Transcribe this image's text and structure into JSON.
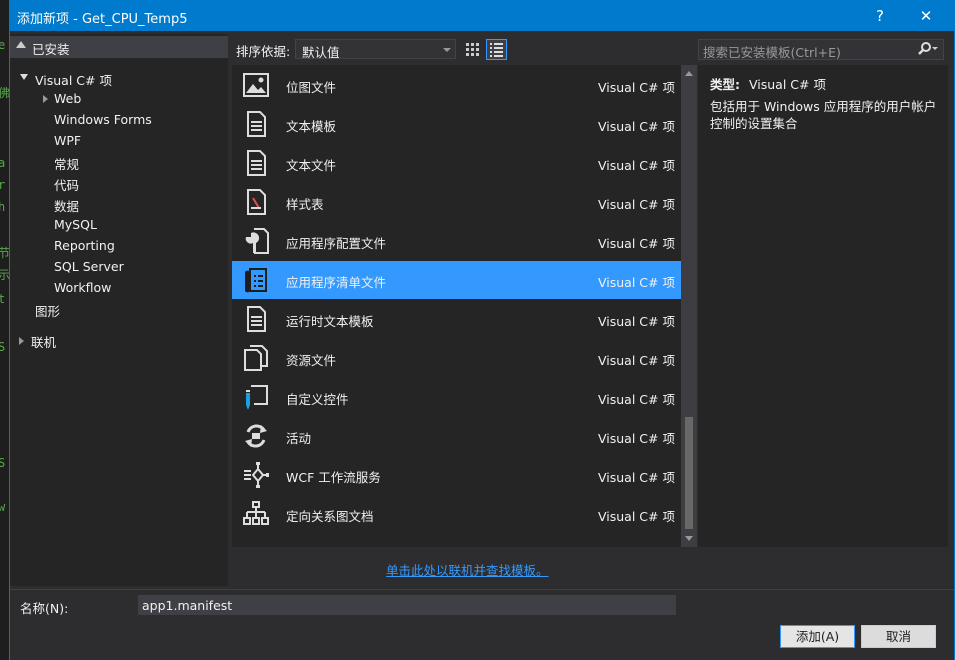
{
  "background_code": [
    "e",
    "佛",
    "a",
    "r",
    "h",
    "节",
    "示",
    "t",
    "S",
    "S",
    "w"
  ],
  "window": {
    "title": "添加新项 - Get_CPU_Temp5",
    "help_label": "?",
    "close_label": "✕"
  },
  "left_pane": {
    "header": "已安装",
    "root": "Visual C# 项",
    "items": [
      "Web",
      "Windows Forms",
      "WPF",
      "常规",
      "代码",
      "数据",
      "MySQL",
      "Reporting",
      "SQL Server",
      "Workflow"
    ],
    "extra": "图形",
    "online": "联机"
  },
  "sort": {
    "label": "排序依据:",
    "value": "默认值"
  },
  "search": {
    "placeholder": "搜索已安装模板(Ctrl+E)"
  },
  "templates": [
    {
      "name": "位图文件",
      "type": "Visual C# 项",
      "icon": "bitmap-icon"
    },
    {
      "name": "文本模板",
      "type": "Visual C# 项",
      "icon": "text-template-icon"
    },
    {
      "name": "文本文件",
      "type": "Visual C# 项",
      "icon": "text-file-icon"
    },
    {
      "name": "样式表",
      "type": "Visual C# 项",
      "icon": "stylesheet-icon"
    },
    {
      "name": "应用程序配置文件",
      "type": "Visual C# 项",
      "icon": "config-file-icon"
    },
    {
      "name": "应用程序清单文件",
      "type": "Visual C# 项",
      "icon": "manifest-file-icon"
    },
    {
      "name": "运行时文本模板",
      "type": "Visual C# 项",
      "icon": "runtime-template-icon"
    },
    {
      "name": "资源文件",
      "type": "Visual C# 项",
      "icon": "resource-file-icon"
    },
    {
      "name": "自定义控件",
      "type": "Visual C# 项",
      "icon": "custom-control-icon"
    },
    {
      "name": "活动",
      "type": "Visual C# 项",
      "icon": "activity-icon"
    },
    {
      "name": "WCF 工作流服务",
      "type": "Visual C# 项",
      "icon": "wcf-workflow-icon"
    },
    {
      "name": "定向关系图文档",
      "type": "Visual C# 项",
      "icon": "dgml-icon"
    }
  ],
  "selected_index": 5,
  "details": {
    "type_label": "类型:",
    "type_value": "Visual C# 项",
    "description": "包括用于 Windows 应用程序的用户帐户控制的设置集合"
  },
  "online_link": "单击此处以联机并查找模板。",
  "bottom": {
    "name_label": "名称(N):",
    "name_value": "app1.manifest",
    "add_label": "添加(A)",
    "cancel_label": "取消"
  },
  "colors": {
    "accent": "#007acc",
    "selection": "#3399ff",
    "background": "#2d2d30"
  }
}
